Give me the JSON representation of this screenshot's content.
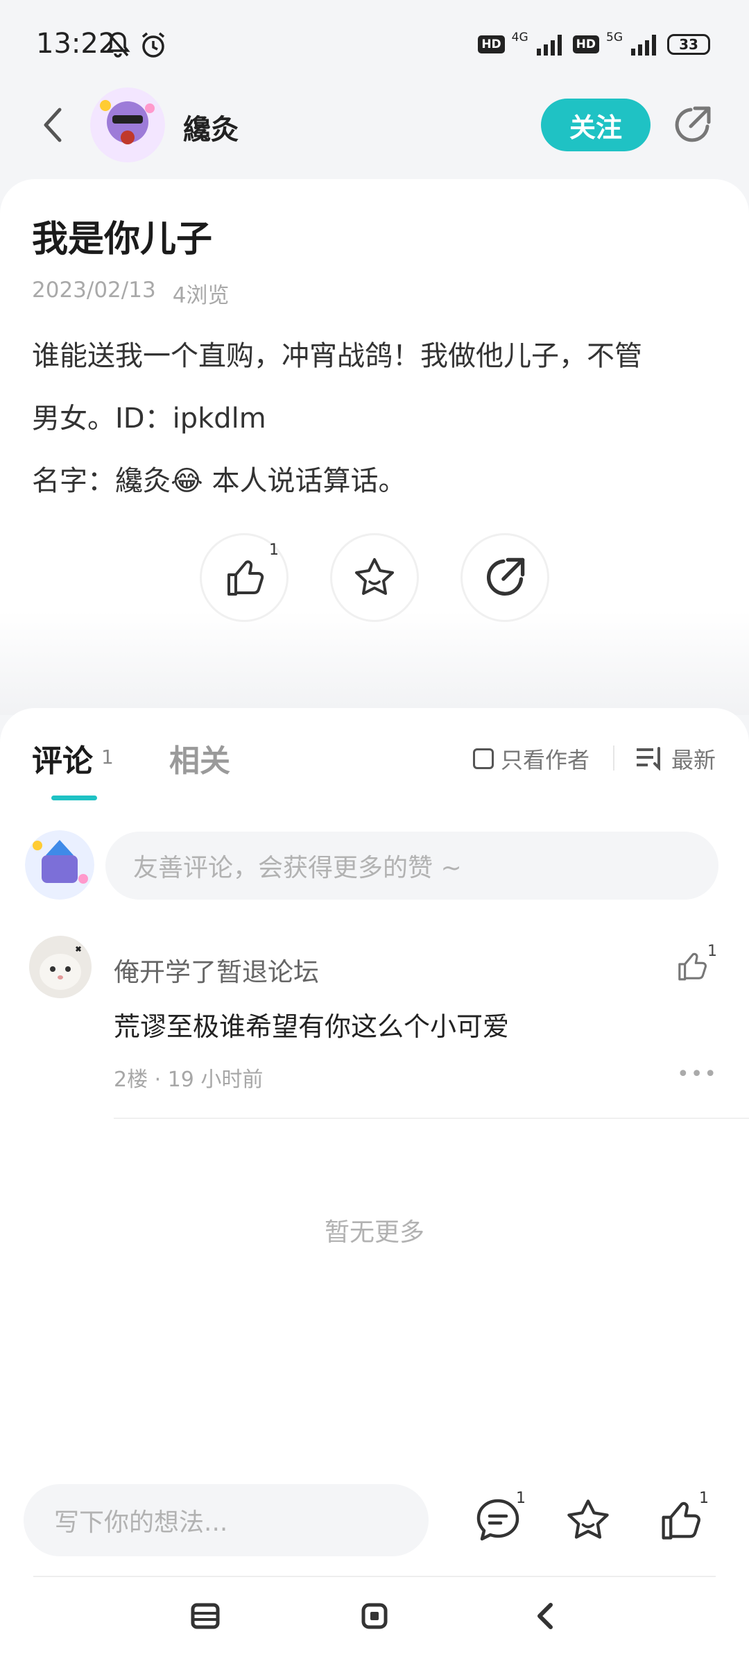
{
  "status_bar": {
    "time": "13:22",
    "hd1": "HD",
    "net1": "4G",
    "hd2": "HD",
    "net2": "5G",
    "battery": "33"
  },
  "header": {
    "author_name": "纔灸",
    "follow_label": "关注"
  },
  "post": {
    "title": "我是你儿子",
    "date": "2023/02/13",
    "views": "4浏览",
    "body_line1": "谁能送我一个直购，冲宵战鸽！我做他儿子，不管",
    "body_line2": "男女。ID：ipkdlm",
    "body_line3_a": "名字：纔灸",
    "body_line3_emoji": "😂",
    "body_line3_b": " 本人说话算话。",
    "like_count": "1"
  },
  "comments_section": {
    "tab_comments": "评论",
    "tab_comments_count": "1",
    "tab_related": "相关",
    "only_author_label": "只看作者",
    "sort_label": "最新",
    "input_placeholder": "友善评论，会获得更多的赞 ~",
    "comments": [
      {
        "author": "俺开学了暂退论坛",
        "text": "荒谬至极谁希望有你这么个小可爱",
        "meta": "2楼 · 19 小时前",
        "likes": "1"
      }
    ],
    "no_more": "暂无更多"
  },
  "bottom_bar": {
    "input_placeholder": "写下你的想法...",
    "comment_count": "1",
    "like_count": "1"
  },
  "colors": {
    "accent": "#1fc2c4",
    "background": "#f4f5f7"
  }
}
